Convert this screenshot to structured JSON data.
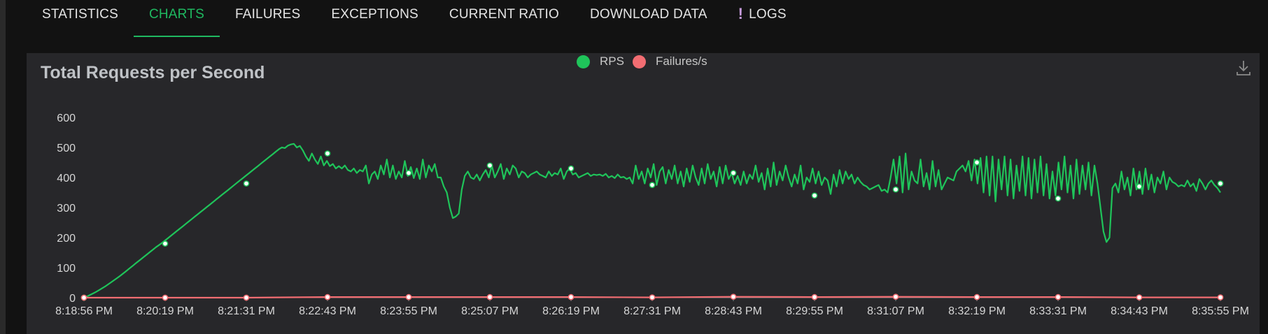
{
  "tabs": [
    {
      "label": "STATISTICS",
      "active": false
    },
    {
      "label": "CHARTS",
      "active": true
    },
    {
      "label": "FAILURES",
      "active": false
    },
    {
      "label": "EXCEPTIONS",
      "active": false
    },
    {
      "label": "CURRENT RATIO",
      "active": false
    },
    {
      "label": "DOWNLOAD DATA",
      "active": false
    },
    {
      "label": "LOGS",
      "active": false,
      "icon": "exclamation-icon"
    }
  ],
  "icons": {
    "download": "download-icon"
  },
  "colors": {
    "accent": "#1fb860",
    "rps": "#1fc45a",
    "failures": "#f26d72",
    "logs_icon": "#c79bdc"
  },
  "chart_data": {
    "type": "line",
    "title": "Total Requests per Second",
    "legend": [
      "RPS",
      "Failures/s"
    ],
    "legend_position": "top-center",
    "ylim": [
      0,
      600
    ],
    "yticks": [
      0,
      100,
      200,
      300,
      400,
      500,
      600
    ],
    "x_ticks": [
      "8:18:56 PM",
      "8:20:19 PM",
      "8:21:31 PM",
      "8:22:43 PM",
      "8:23:55 PM",
      "8:25:07 PM",
      "8:26:19 PM",
      "8:27:31 PM",
      "8:28:43 PM",
      "8:29:55 PM",
      "8:31:07 PM",
      "8:32:19 PM",
      "8:33:31 PM",
      "8:34:43 PM",
      "8:35:55 PM"
    ],
    "grid": false,
    "series": [
      {
        "name": "RPS",
        "values": [
          0,
          180,
          380,
          480,
          415,
          440,
          430,
          375,
          415,
          340,
          360,
          450,
          330,
          370,
          380
        ],
        "detail": [
          0,
          4,
          9,
          14,
          19,
          25,
          31,
          37,
          44,
          51,
          58,
          65,
          72,
          80,
          88,
          96,
          104,
          112,
          120,
          128,
          136,
          144,
          152,
          160,
          168,
          175,
          182,
          190,
          198,
          206,
          214,
          222,
          230,
          238,
          246,
          254,
          262,
          270,
          278,
          286,
          294,
          302,
          310,
          318,
          326,
          334,
          342,
          350,
          358,
          366,
          374,
          382,
          390,
          398,
          406,
          414,
          422,
          430,
          438,
          446,
          454,
          462,
          470,
          478,
          486,
          494,
          500,
          498,
          506,
          510,
          512,
          500,
          505,
          490,
          470,
          455,
          480,
          460,
          445,
          470,
          440,
          455,
          438,
          445,
          430,
          438,
          430,
          440,
          425,
          420,
          430,
          415,
          425,
          420,
          440,
          380,
          410,
          420,
          395,
          440,
          410,
          460,
          400,
          440,
          395,
          420,
          400,
          455,
          405,
          435,
          398,
          430,
          395,
          460,
          400,
          440,
          420,
          445,
          400,
          400,
          370,
          350,
          300,
          265,
          270,
          280,
          360,
          405,
          420,
          400,
          395,
          410,
          390,
          410,
          425,
          400,
          440,
          400,
          420,
          445,
          395,
          430,
          410,
          440,
          430,
          400,
          420,
          415,
          400,
          410,
          415,
          420,
          410,
          405,
          400,
          420,
          405,
          415,
          410,
          430,
          395,
          420,
          430,
          410,
          415,
          400,
          405,
          410,
          415,
          405,
          410,
          408,
          410,
          405,
          412,
          400,
          405,
          398,
          410,
          400,
          402,
          395,
          400,
          380,
          440,
          395,
          420,
          380,
          430,
          400,
          445,
          375,
          420,
          435,
          380,
          425,
          395,
          440,
          380,
          420,
          370,
          430,
          385,
          440,
          400,
          375,
          430,
          380,
          445,
          395,
          420,
          370,
          435,
          380,
          440,
          395,
          415,
          380,
          405,
          375,
          420,
          380,
          410,
          395,
          440,
          385,
          415,
          360,
          430,
          370,
          450,
          375,
          420,
          390,
          440,
          400,
          370,
          410,
          380,
          440,
          360,
          400,
          385,
          430,
          380,
          420,
          375,
          400,
          390,
          345,
          410,
          370,
          425,
          380,
          420,
          395,
          410,
          380,
          400,
          385,
          375,
          370,
          360,
          365,
          370,
          375,
          355,
          360,
          350,
          400,
          460,
          380,
          470,
          350,
          480,
          360,
          420,
          390,
          380,
          460,
          370,
          415,
          360,
          455,
          370,
          425,
          360,
          380,
          400,
          395,
          390,
          420,
          430,
          440,
          420,
          455,
          390,
          460,
          380,
          465,
          350,
          470,
          340,
          470,
          320,
          460,
          360,
          470,
          340,
          460,
          330,
          440,
          355,
          470,
          340,
          465,
          330,
          460,
          350,
          470,
          340,
          445,
          330,
          420,
          340,
          450,
          360,
          470,
          350,
          440,
          330,
          460,
          345,
          440,
          360,
          450,
          340,
          440,
          380,
          300,
          220,
          185,
          200,
          365,
          380,
          350,
          420,
          360,
          400,
          340,
          430,
          360,
          420,
          345,
          430,
          360,
          410,
          350,
          400,
          380,
          420,
          360,
          400,
          385,
          380,
          370,
          375,
          370,
          390,
          370,
          380,
          355,
          395,
          380,
          360,
          380,
          390,
          375,
          365,
          350
        ]
      },
      {
        "name": "Failures/s",
        "values": [
          0,
          0,
          0,
          2,
          2,
          2,
          2,
          1,
          3,
          2,
          3,
          2,
          2,
          1,
          1
        ]
      }
    ]
  }
}
